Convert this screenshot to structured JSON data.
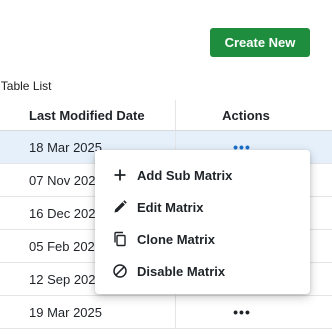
{
  "toolbar": {
    "create_label": "Create New"
  },
  "list_caption": "e Table List",
  "table": {
    "headers": {
      "date": "Last Modified Date",
      "actions": "Actions"
    },
    "rows": [
      {
        "date": "18 Mar 2025",
        "actions": "•••"
      },
      {
        "date": "07 Nov 2024",
        "actions": "•••"
      },
      {
        "date": "16 Dec 2024",
        "actions": "•••"
      },
      {
        "date": "05 Feb 2025",
        "actions": "•••"
      },
      {
        "date": "12 Sep 2024",
        "actions": "•••"
      },
      {
        "date": "19 Mar 2025",
        "actions": "•••"
      }
    ]
  },
  "menu": {
    "items": [
      {
        "label": "Add Sub Matrix",
        "icon": "plus-icon"
      },
      {
        "label": "Edit Matrix",
        "icon": "pencil-icon"
      },
      {
        "label": "Clone Matrix",
        "icon": "copy-icon"
      },
      {
        "label": "Disable Matrix",
        "icon": "block-icon"
      }
    ]
  },
  "colors": {
    "accent": "#1e8e3e",
    "selected_row": "#e6f0fb",
    "link": "#1a6fc9"
  }
}
